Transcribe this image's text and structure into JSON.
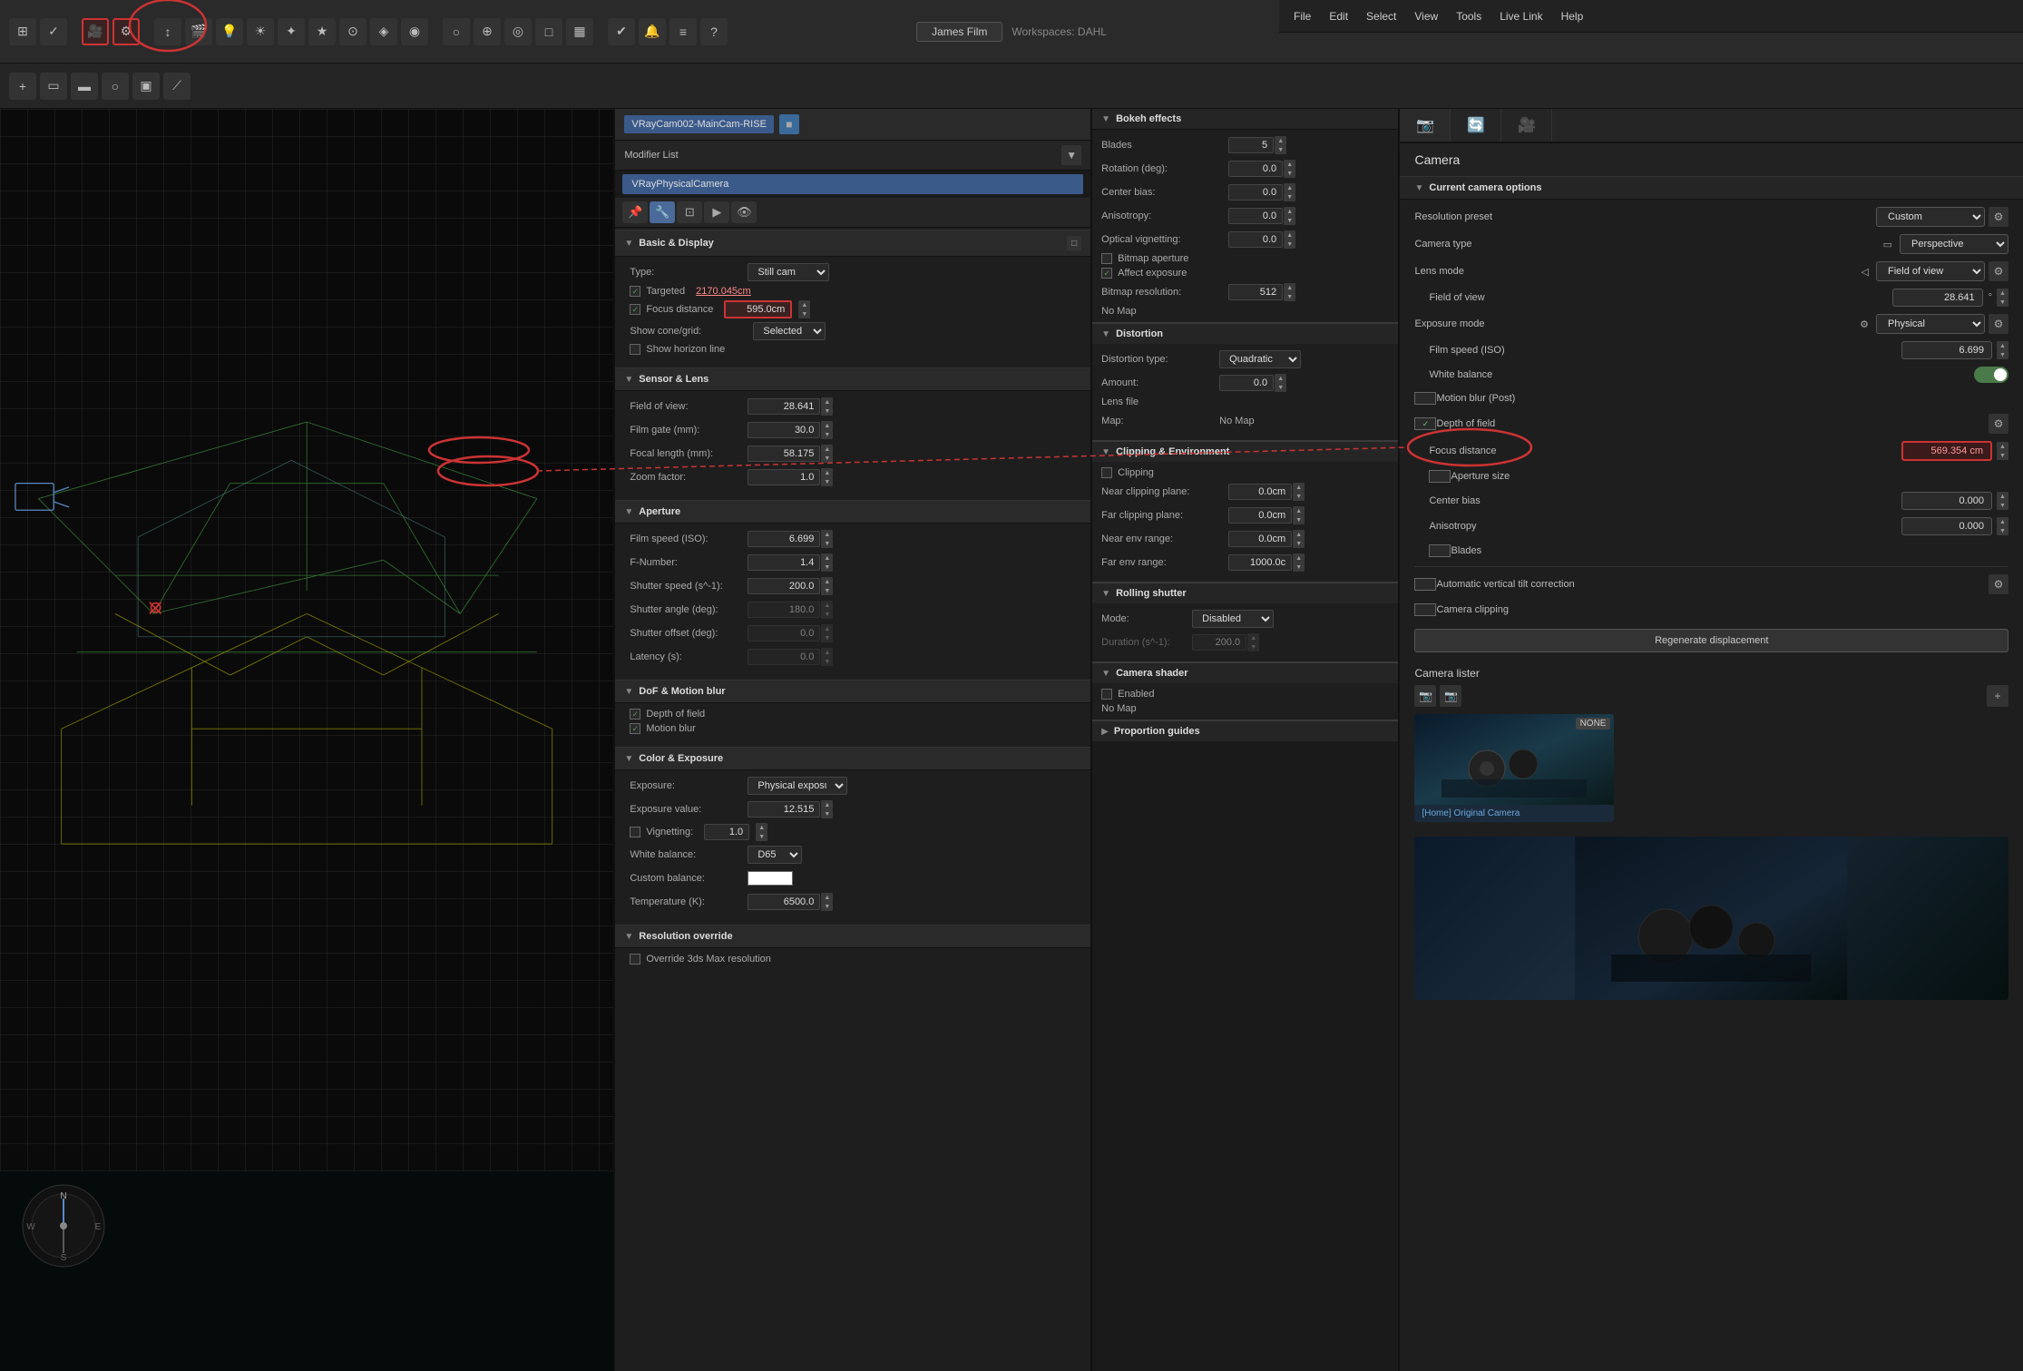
{
  "app": {
    "title": "James Film",
    "workspace": "Workspaces: DAHL"
  },
  "menubar": {
    "items": [
      "File",
      "Edit",
      "Select",
      "View",
      "Tools",
      "Live Link",
      "Help"
    ]
  },
  "toolbar": {
    "icons": [
      "grid",
      "check",
      "star",
      "globe",
      "gear",
      "scene",
      "camera",
      "light",
      "helper",
      "shape",
      "modifier",
      "hierarchy",
      "motion",
      "display",
      "utilities",
      "render",
      "env",
      "effects",
      "anim",
      "track",
      "schematic",
      "material",
      "texmap",
      "color",
      "customize",
      "script",
      "misc1",
      "misc2",
      "misc3",
      "misc4",
      "misc5",
      "misc6",
      "misc7"
    ]
  },
  "object": {
    "name": "VRayCam002-MainCam-RISE",
    "modifier_list": "Modifier List",
    "modifier_item": "VRayPhysicalCamera"
  },
  "basic_display": {
    "title": "Basic & Display",
    "type_label": "Type:",
    "type_value": "Still cam",
    "targeted_label": "Targeted",
    "targeted_value": "2170.045cm",
    "focus_distance_label": "Focus distance",
    "focus_distance_value": "595.0cm",
    "show_cone_label": "Show cone/grid:",
    "show_cone_value": "Selected",
    "show_horizon_label": "Show horizon line"
  },
  "sensor_lens": {
    "title": "Sensor & Lens",
    "fov_label": "Field of view:",
    "fov_value": "28.641",
    "film_gate_label": "Film gate (mm):",
    "film_gate_value": "30.0",
    "focal_length_label": "Focal length (mm):",
    "focal_length_value": "58.175",
    "zoom_factor_label": "Zoom factor:",
    "zoom_factor_value": "1.0"
  },
  "aperture": {
    "title": "Aperture",
    "film_speed_label": "Film speed (ISO):",
    "film_speed_value": "6.699",
    "f_number_label": "F-Number:",
    "f_number_value": "1.4",
    "shutter_speed_label": "Shutter speed (s^-1):",
    "shutter_speed_value": "200.0",
    "shutter_angle_label": "Shutter angle (deg):",
    "shutter_angle_value": "180.0",
    "shutter_offset_label": "Shutter offset (deg):",
    "shutter_offset_value": "0.0",
    "latency_label": "Latency (s):",
    "latency_value": "0.0"
  },
  "dof_motion_blur": {
    "title": "DoF & Motion blur",
    "depth_of_field": "Depth of field",
    "motion_blur": "Motion blur"
  },
  "color_exposure": {
    "title": "Color & Exposure",
    "exposure_label": "Exposure:",
    "exposure_value": "Physical exposur",
    "exposure_value_label": "Exposure value:",
    "exposure_value_num": "12.515",
    "vignetting_label": "Vignetting:",
    "vignetting_value": "1.0",
    "white_balance_label": "White balance:",
    "white_balance_value": "D65",
    "custom_balance_label": "Custom balance:",
    "temperature_label": "Temperature (K):",
    "temperature_value": "6500.0"
  },
  "resolution_override": {
    "title": "Resolution override",
    "override_label": "Override 3ds Max resolution"
  },
  "bokeh": {
    "title": "Bokeh effects",
    "blades_label": "Blades",
    "blades_value": "5",
    "rotation_label": "Rotation (deg):",
    "rotation_value": "0.0",
    "center_bias_label": "Center bias:",
    "center_bias_value": "0.0",
    "anisotropy_label": "Anisotropy:",
    "anisotropy_value": "0.0",
    "optical_vignetting_label": "Optical vignetting:",
    "optical_vignetting_value": "0.0",
    "bitmap_aperture_label": "Bitmap aperture",
    "affect_exposure_label": "Affect exposure",
    "bitmap_resolution_label": "Bitmap resolution:",
    "bitmap_resolution_value": "512",
    "no_map": "No Map"
  },
  "distortion": {
    "title": "Distortion",
    "distortion_type_label": "Distortion type:",
    "distortion_type_value": "Quadratic",
    "amount_label": "Amount:",
    "amount_value": "0.0",
    "lens_file_label": "Lens file",
    "map_label": "Map:",
    "map_value": "No Map"
  },
  "clipping": {
    "title": "Clipping & Environment",
    "clipping_label": "Clipping",
    "near_clipping_label": "Near clipping plane:",
    "near_clipping_value": "0.0cm",
    "far_clipping_label": "Far clipping plane:",
    "far_clipping_value": "0.0cm",
    "near_env_label": "Near env range:",
    "near_env_value": "0.0cm",
    "far_env_label": "Far env range:",
    "far_env_value": "1000.0c"
  },
  "rolling_shutter": {
    "title": "Rolling shutter",
    "mode_label": "Mode:",
    "mode_value": "Disabled",
    "duration_label": "Duration (s^-1):",
    "duration_value": "200.0"
  },
  "camera_shader": {
    "title": "Camera shader",
    "enabled_label": "Enabled",
    "no_map": "No Map"
  },
  "proportion_guides": {
    "title": "Proportion guides"
  },
  "right_panel": {
    "camera_label": "Camera",
    "current_camera_options": "Current camera options",
    "resolution_preset_label": "Resolution preset",
    "resolution_preset_value": "Custom",
    "camera_type_label": "Camera type",
    "camera_type_value": "Perspective",
    "lens_mode_label": "Lens mode",
    "lens_mode_value": "Field of view",
    "field_of_view_label": "Field of view",
    "field_of_view_value": "28.641",
    "field_of_view_unit": "°",
    "exposure_mode_label": "Exposure mode",
    "exposure_mode_value": "Physical",
    "film_speed_label": "Film speed (ISO)",
    "film_speed_value": "6.699",
    "white_balance_label": "White balance",
    "motion_blur_label": "Motion blur (Post)",
    "depth_of_field_label": "Depth of field",
    "focus_distance_label": "Focus distance",
    "focus_distance_value": "569.354 cm",
    "aperture_size_label": "Aperture size",
    "center_bias_label": "Center bias",
    "center_bias_value": "0.000",
    "anisotropy_label": "Anisotropy",
    "anisotropy_value": "0.000",
    "blades_label": "Blades",
    "auto_vertical_tilt_label": "Automatic vertical tilt correction",
    "camera_clipping_label": "Camera clipping",
    "regenerate_btn": "Regenerate displacement",
    "camera_lister_title": "Camera lister",
    "camera_thumb_name": "[Home] Original Camera",
    "none_badge": "NONE"
  }
}
